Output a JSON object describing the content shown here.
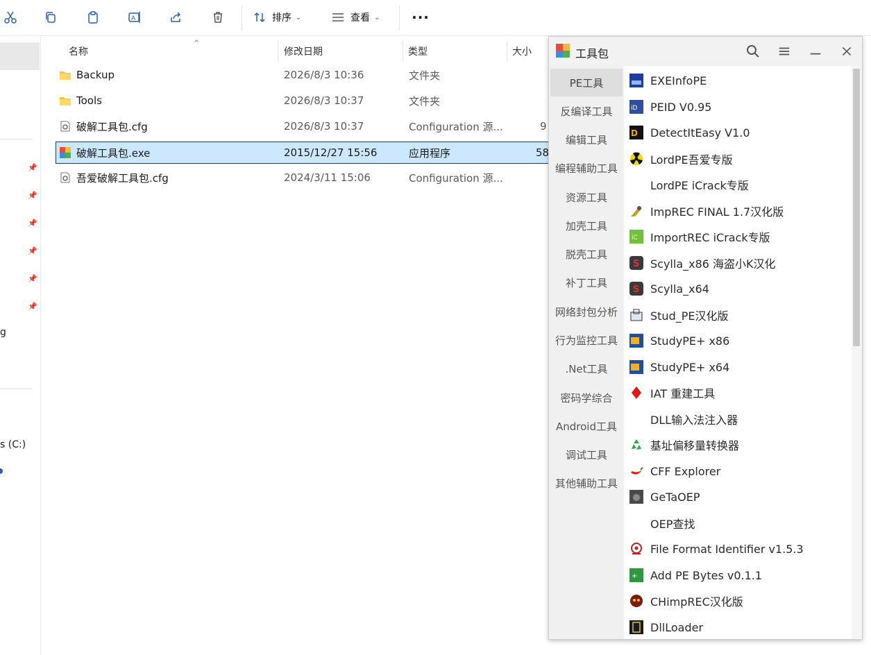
{
  "toolbar": {
    "sort_label": "排序",
    "view_label": "查看",
    "more_label": "···"
  },
  "nav": {
    "fragment_g": "g",
    "fragment_drive": "s (C:)"
  },
  "filelist": {
    "columns": {
      "name": "名称",
      "date": "修改日期",
      "type": "类型",
      "size": "大小"
    },
    "rows": [
      {
        "name": "Backup",
        "date": "2026/8/3 10:36",
        "type": "文件夹",
        "size": ""
      },
      {
        "name": "Tools",
        "date": "2026/8/3 10:37",
        "type": "文件夹",
        "size": ""
      },
      {
        "name": "破解工具包.cfg",
        "date": "2026/8/3 10:37",
        "type": "Configuration 源...",
        "size": "9"
      },
      {
        "name": "破解工具包.exe",
        "date": "2015/12/27 15:56",
        "type": "应用程序",
        "size": "58"
      },
      {
        "name": "吾爱破解工具包.cfg",
        "date": "2024/3/11 15:06",
        "type": "Configuration 源...",
        "size": ""
      }
    ]
  },
  "toolbox": {
    "title": "工具包",
    "categories": [
      "PE工具",
      "反编译工具",
      "编辑工具",
      "编程辅助工具",
      "资源工具",
      "加壳工具",
      "脱壳工具",
      "补丁工具",
      "网络封包分析",
      "行为监控工具",
      ".Net工具",
      "密码学综合",
      "Android工具",
      "调试工具",
      "其他辅助工具"
    ],
    "tools": [
      "EXEInfoPE",
      "PEID V0.95",
      "DetectItEasy V1.0",
      "LordPE吾爱专版",
      "LordPE iCrack专版",
      "ImpREC FINAL 1.7汉化版",
      "ImportREC iCrack专版",
      "Scylla_x86 海盗小K汉化",
      "Scylla_x64",
      "Stud_PE汉化版",
      "StudyPE+ x86",
      "StudyPE+ x64",
      "IAT 重建工具",
      "DLL输入法注入器",
      "基址偏移量转换器",
      "CFF Explorer",
      "GeTaOEP",
      "OEP查找",
      "File Format Identifier v1.5.3",
      "Add PE Bytes v0.1.1",
      "CHimpREC汉化版",
      "DllLoader"
    ]
  },
  "colors": {
    "accent": "#2b5fa8",
    "selection": "#cce8ff",
    "folder": "#f4c542"
  }
}
